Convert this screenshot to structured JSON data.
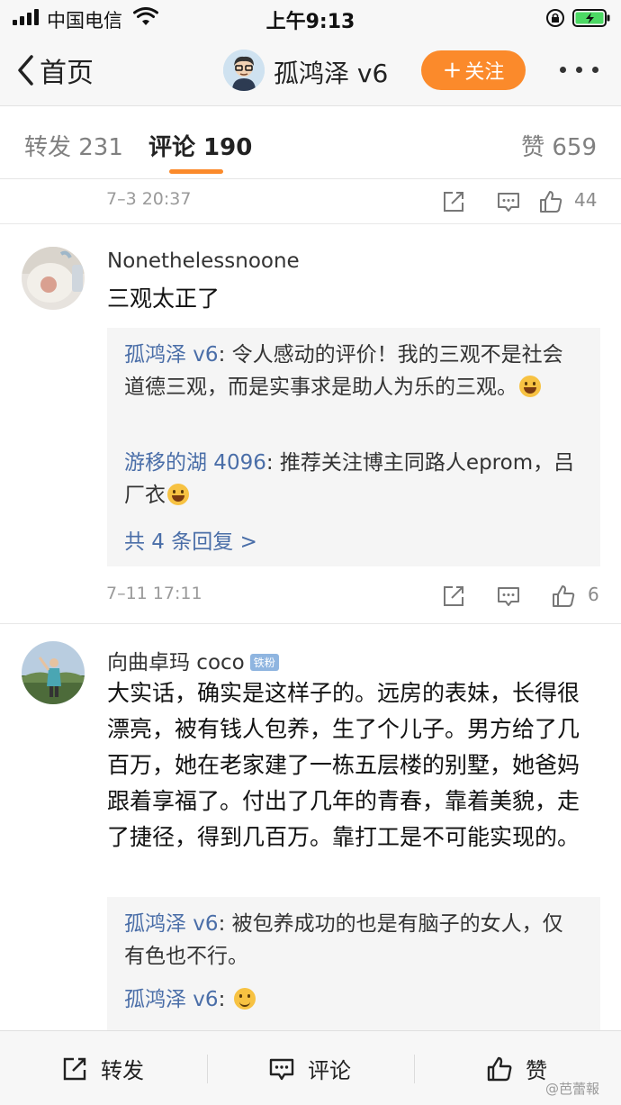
{
  "status_bar": {
    "carrier": "中国电信",
    "time": "上午9:13"
  },
  "nav": {
    "back_label": "首页",
    "title": "孤鸿泽 v6",
    "follow_label": "关注"
  },
  "tabs": {
    "repost": "转发 231",
    "comment": "评论 190",
    "like": "赞 659"
  },
  "comments": [
    {
      "time": "7–3 20:37",
      "likes": "44"
    },
    {
      "user": "Nonethelessnoone",
      "text": "三观太正了",
      "replies": [
        {
          "author": "孤鸿泽 v6",
          "text": ": 令人感动的评价！我的三观不是社会道德三观，而是实事求是助人为乐的三观。"
        },
        {
          "author": "游移的湖 4096",
          "text": ": 推荐关注博主同路人eprom，吕厂衣"
        }
      ],
      "more_replies": "共 4 条回复 >",
      "time": "7–11 17:11",
      "likes": "6"
    },
    {
      "user": "向曲卓玛 coco",
      "badge": "铁粉",
      "text": "大实话，确实是这样子的。远房的表妹，长得很漂亮，被有钱人包养，生了个儿子。男方给了几百万，她在老家建了一栋五层楼的别墅，她爸妈跟着享福了。付出了几年的青春，靠着美貌，走了捷径，得到几百万。靠打工是不可能实现的。",
      "replies": [
        {
          "author": "孤鸿泽 v6",
          "text": ": 被包养成功的也是有脑子的女人，仅有色也不行。"
        },
        {
          "author": "孤鸿泽 v6",
          "text": ": "
        }
      ]
    }
  ],
  "bottom_bar": {
    "repost": "转发",
    "comment": "评论",
    "like": "赞"
  },
  "watermark": "@芭蕾報",
  "colors": {
    "accent": "#fb8a2b",
    "link": "#4a6ea8"
  }
}
